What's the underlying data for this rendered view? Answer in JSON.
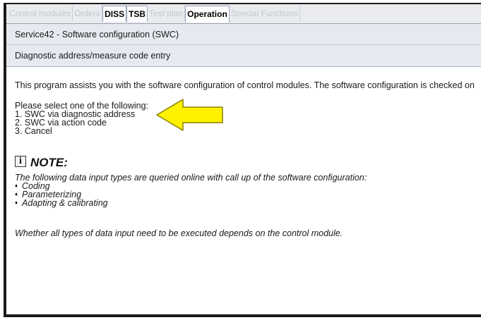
{
  "tabs": [
    {
      "label": "Control modules",
      "state": "disabled"
    },
    {
      "label": "Orders",
      "state": "disabled"
    },
    {
      "label": "DISS",
      "state": "enabled"
    },
    {
      "label": "TSB",
      "state": "enabled"
    },
    {
      "label": "Test plan",
      "state": "disabled"
    },
    {
      "label": "Operation",
      "state": "active"
    },
    {
      "label": "Special Functions",
      "state": "disabled"
    }
  ],
  "header": {
    "title": "Service42 - Software configuration (SWC)",
    "subtitle": "Diagnostic address/measure code entry"
  },
  "main": {
    "intro": "This program assists you with the software configuration of control modules. The software configuration is checked on",
    "prompt": "Please select one of the following:",
    "options": [
      "1. SWC via diagnostic address",
      "2. SWC via action code",
      "3. Cancel"
    ],
    "note_icon_glyph": "i",
    "note_title": "NOTE:",
    "note_text": "The following data input types are queried online with call up of the software configuration:",
    "note_bullets": [
      "Coding",
      "Parameterizing",
      "Adapting & calibrating"
    ],
    "bullet_glyph": "♦",
    "note_footer": "Whether all types of data input need to be executed depends on the control module."
  },
  "colors": {
    "arrow_fill": "#fff200",
    "arrow_stroke": "#8a8200",
    "header_bg": "#e6eaf0"
  },
  "icons": {
    "note": "info-icon",
    "pointer": "yellow-arrow"
  }
}
